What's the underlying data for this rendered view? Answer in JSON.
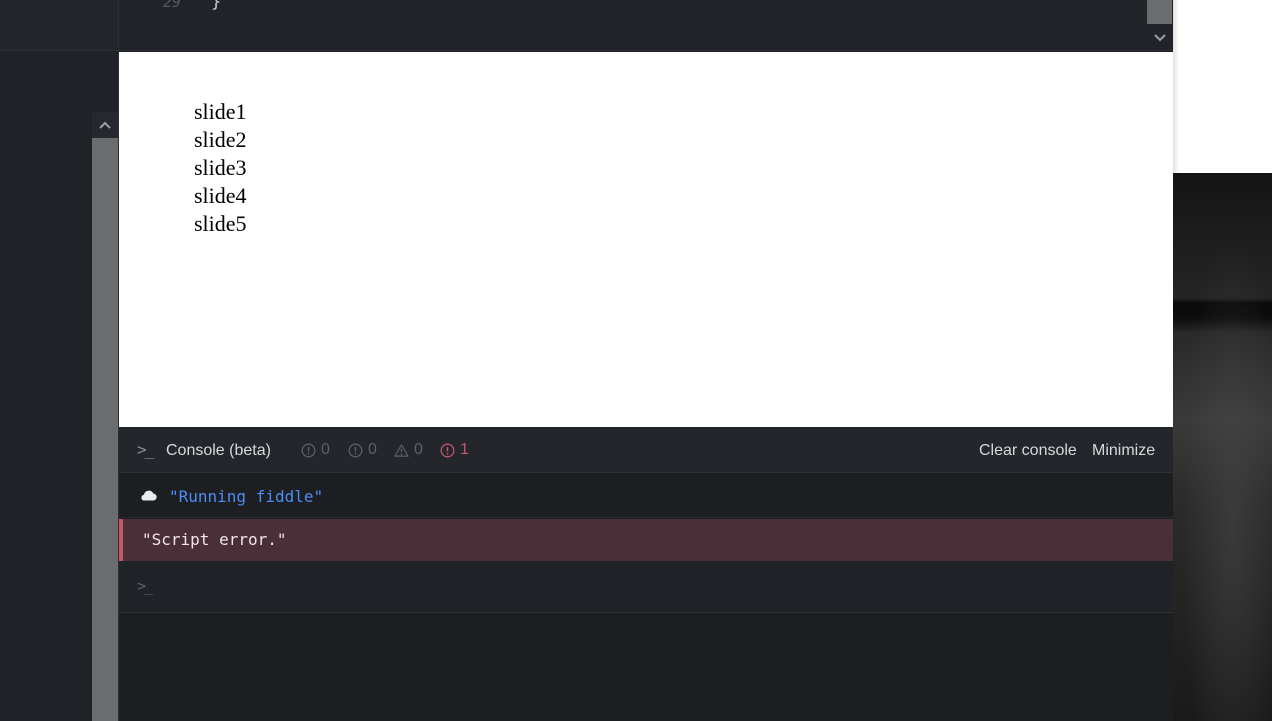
{
  "editor": {
    "line_number": "29",
    "code_line": "}"
  },
  "result": {
    "slides": [
      "slide1",
      "slide2",
      "slide3",
      "slide4",
      "slide5"
    ]
  },
  "console": {
    "prompt_glyph": ">_",
    "title": "Console (beta)",
    "counters": {
      "log": "0",
      "info": "0",
      "warn": "0",
      "error": "1"
    },
    "clear_label": "Clear console",
    "minimize_label": "Minimize",
    "messages": {
      "running": "\"Running fiddle\"",
      "error": "\"Script error.\""
    },
    "input_prompt": ">_"
  },
  "colors": {
    "accent_blue": "#4b8cf5",
    "error_red": "#c2566b",
    "error_row_bg": "#4a2f38"
  }
}
